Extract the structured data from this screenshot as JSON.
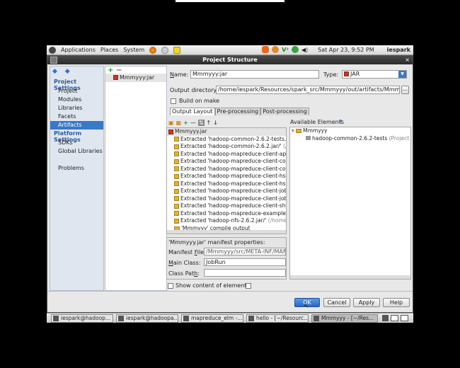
{
  "panel": {
    "menus": [
      "Applications",
      "Places",
      "System"
    ],
    "datetime": "Sat Apr 23,  9:52 PM",
    "user": "iespark"
  },
  "window": {
    "title": "Project Structure",
    "close": "×"
  },
  "nav": {
    "project_settings": "Project Settings",
    "project_items": [
      "Project",
      "Modules",
      "Libraries",
      "Facets",
      "Artifacts"
    ],
    "platform_settings": "Platform Settings",
    "platform_items": [
      "SDKs",
      "Global Libraries"
    ],
    "problems": "Problems",
    "selected": "Artifacts"
  },
  "artifacts": {
    "add": "+",
    "remove": "−",
    "items": [
      "Mmmyyy:jar"
    ]
  },
  "form": {
    "name_label": "Name:",
    "name_value": "Mmmyyy:jar",
    "type_label": "Type:",
    "type_value": "JAR",
    "output_label": "Output directory:",
    "output_value": "/home/iespark/Resources/spark_src/Mmmyyy/out/artifacts/Mmmyyy_jar",
    "browse": "...",
    "build_on_make": "Build on make",
    "tabs": [
      "Output Layout",
      "Pre-processing",
      "Post-processing"
    ],
    "available_label": "Available Elements",
    "help_q": "?"
  },
  "layout_tree": {
    "root": "Mmmyyy.jar",
    "items": [
      {
        "text": "Extracted 'hadoop-common-2.6.2-tests.jar",
        "sub": ""
      },
      {
        "text": "Extracted 'hadoop-common-2.6.2.jar/'",
        "sub": " (/ho"
      },
      {
        "text": "Extracted 'hadoop-mapreduce-client-app-2",
        "sub": ""
      },
      {
        "text": "Extracted 'hadoop-mapreduce-client-comr",
        "sub": ""
      },
      {
        "text": "Extracted 'hadoop-mapreduce-client-core-",
        "sub": ""
      },
      {
        "text": "Extracted 'hadoop-mapreduce-client-hs-2.",
        "sub": ""
      },
      {
        "text": "Extracted 'hadoop-mapreduce-client-hs-pl",
        "sub": ""
      },
      {
        "text": "Extracted 'hadoop-mapreduce-client-jobcli",
        "sub": ""
      },
      {
        "text": "Extracted 'hadoop-mapreduce-client-jobcli",
        "sub": ""
      },
      {
        "text": "Extracted 'hadoop-mapreduce-client-shuff",
        "sub": ""
      },
      {
        "text": "Extracted 'hadoop-mapreduce-examples-2",
        "sub": ""
      },
      {
        "text": "Extracted 'hadoop-nfs-2.6.2.jar/'",
        "sub": " (/home/ie"
      }
    ],
    "compile_output": "'Mmmyyy' compile output"
  },
  "available_tree": {
    "root": "Mmmyyy",
    "items": [
      {
        "text": "hadoop-common-2.6.2-tests",
        "sub": " (Project Libr"
      }
    ]
  },
  "manifest": {
    "title": "'Mmmyyy.jar' manifest properties:",
    "file_label": "Manifest File:",
    "file_value": "/Mmmyyy/src/META-INF/MANIFEST",
    "main_label": "Main Class:",
    "main_value": "JobRun",
    "classpath_label": "Class Path:",
    "classpath_value": ""
  },
  "show_content": "Show content of elements",
  "buttons": {
    "ok": "OK",
    "cancel": "Cancel",
    "apply": "Apply",
    "help": "Help"
  },
  "taskbar": [
    {
      "label": "iespark@hadoop..."
    },
    {
      "label": "iespark@hadoopa..."
    },
    {
      "label": "mapreduce_elm -..."
    },
    {
      "label": "hello - [~/Resourc..."
    },
    {
      "label": "Mmmyyy - [~/Res..."
    }
  ]
}
